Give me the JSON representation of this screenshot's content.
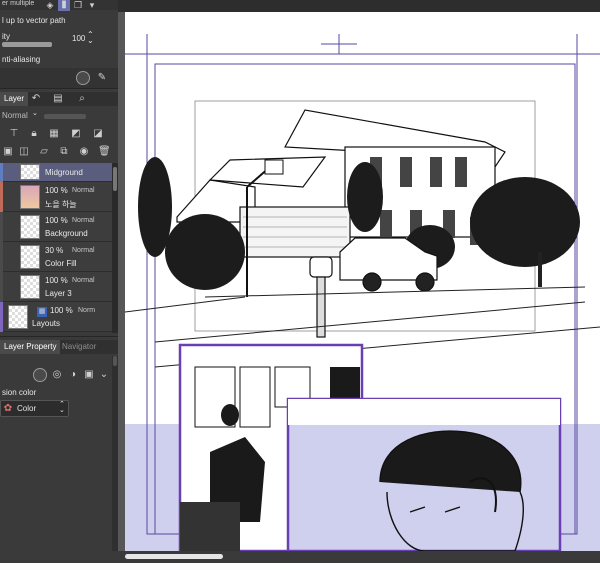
{
  "tool_property": {
    "vector_label": "l up to vector path",
    "opacity_label": "ity",
    "opacity_value": "100",
    "antialias_label": "nti-aliasing",
    "top_label": "er multiple"
  },
  "layer_panel": {
    "tab_label": "Layer",
    "blend_mode": "Normal",
    "layers": [
      {
        "opacity": "",
        "mode": "",
        "name": "Midground",
        "selected": true,
        "bar": "#5f7ec0"
      },
      {
        "opacity": "100 %",
        "mode": "Normal",
        "name": "노을 하늘",
        "selected": false,
        "bar": "#c06a5a"
      },
      {
        "opacity": "100 %",
        "mode": "Normal",
        "name": "Background",
        "selected": false,
        "bar": "#4a4a4a"
      },
      {
        "opacity": "30 %",
        "mode": "Normal",
        "name": "Color Fill",
        "selected": false,
        "bar": "#4a4a4a"
      },
      {
        "opacity": "100 %",
        "mode": "Normal",
        "name": "Layer 3",
        "selected": false,
        "bar": "#4a4a4a"
      },
      {
        "opacity": "100 %",
        "mode": "Norm",
        "name": "Layouts",
        "selected": false,
        "bar": "#7d65c0"
      }
    ]
  },
  "bottom_panel": {
    "tab_layer_property": "Layer Property",
    "tab_navigator": "Navigator",
    "expression_label": "sion color",
    "color_select": "Color"
  },
  "colors": {
    "panel_bg": "#3a3a3a",
    "accent_purple": "#6a3fb4",
    "selected_layer": "#5a5d7e",
    "panel_tint": "#cfcfee"
  }
}
